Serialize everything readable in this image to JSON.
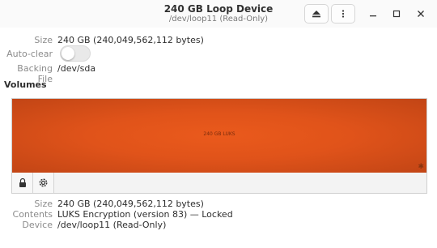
{
  "window": {
    "title": "240 GB Loop Device",
    "subtitle": "/dev/loop11 (Read-Only)"
  },
  "device": {
    "size_label": "Size",
    "size_value": "240 GB (240,049,562,112 bytes)",
    "autoclear_label": "Auto-clear",
    "autoclear_on": false,
    "backing_label": "Backing File",
    "backing_value": "/dev/sda"
  },
  "volumes": {
    "title": "Volumes",
    "partition_label": "240 GB LUKS",
    "partition_color": "#e95420"
  },
  "selected": {
    "size_label": "Size",
    "size_value": "240 GB (240,049,562,112 bytes)",
    "contents_label": "Contents",
    "contents_value": "LUKS Encryption (version 83) — Locked",
    "device_label": "Device",
    "device_value": "/dev/loop11 (Read-Only)"
  },
  "icons": {
    "eject": "eject-icon",
    "menu": "kebab-menu-icon",
    "minimize": "minimize-icon",
    "maximize": "maximize-icon",
    "close": "close-icon",
    "unlock": "padlock-icon",
    "settings": "gear-icon"
  }
}
